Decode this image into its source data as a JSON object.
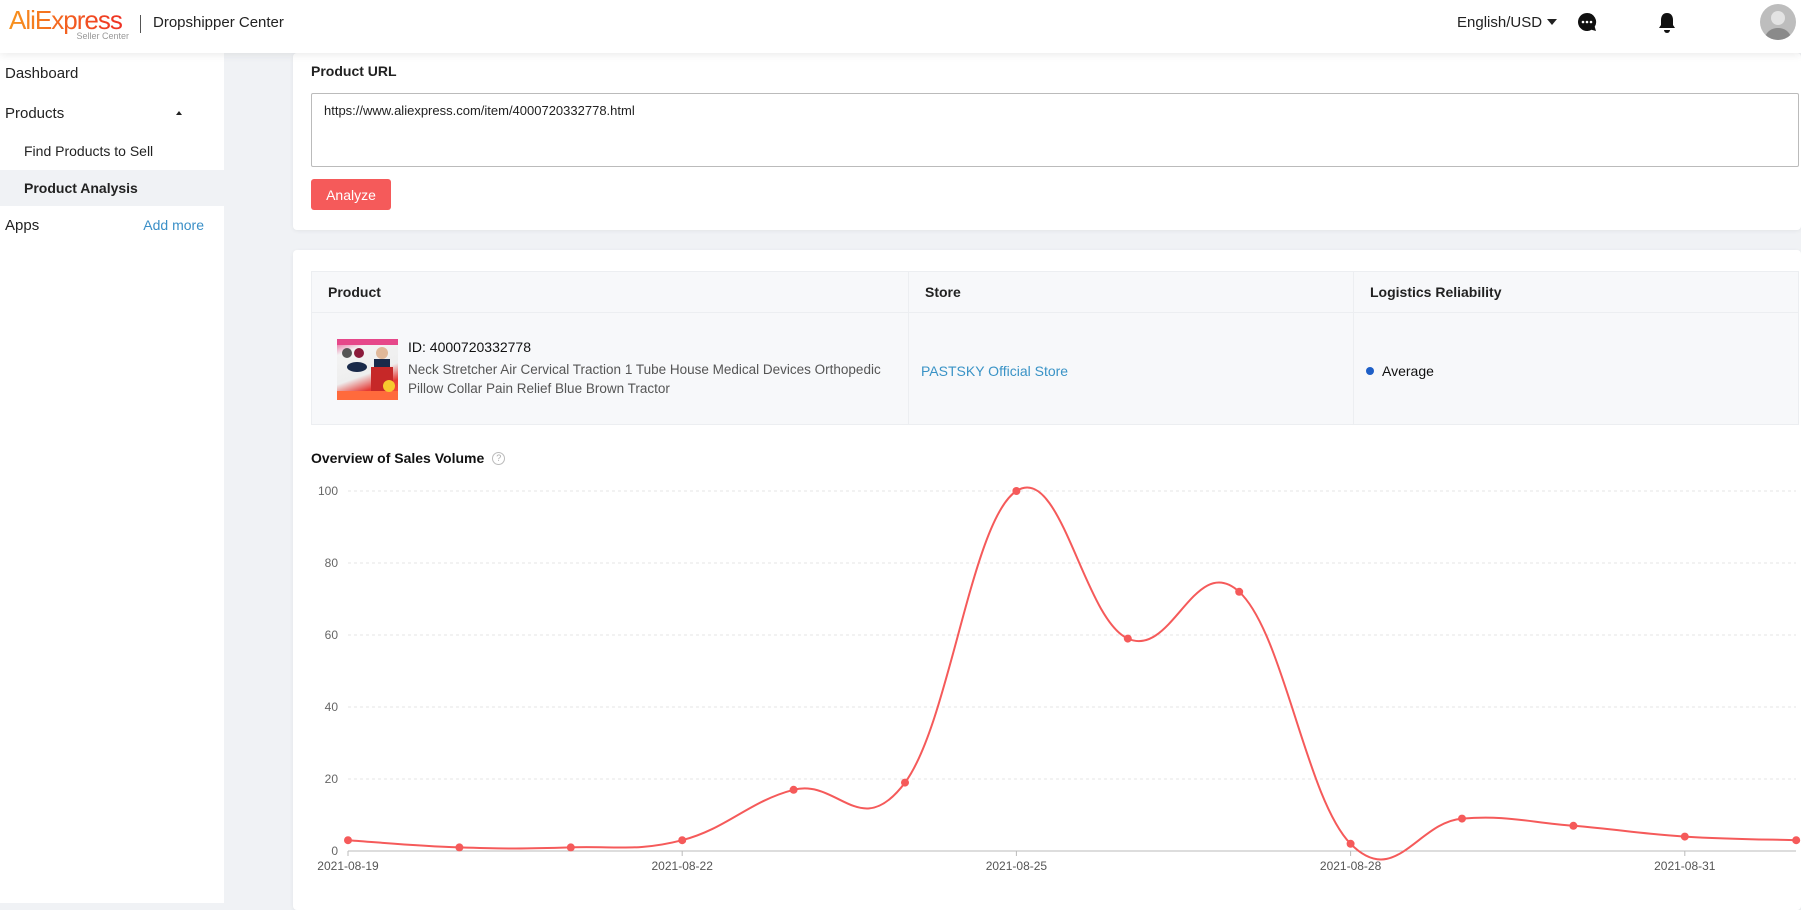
{
  "header": {
    "logo_text": "AliExpress",
    "logo_sub": "Seller Center",
    "app_title": "Dropshipper Center",
    "language": "English/USD",
    "icons": [
      "chat-icon",
      "bell-icon",
      "avatar"
    ]
  },
  "sidebar": {
    "items": [
      {
        "label": "Dashboard"
      },
      {
        "label": "Products"
      },
      {
        "label": "Find Products to Sell"
      },
      {
        "label": "Product Analysis",
        "active": true
      },
      {
        "label": "Apps"
      }
    ],
    "add_more": "Add more"
  },
  "url_card": {
    "label": "Product URL",
    "value": "https://www.aliexpress.com/item/4000720332778.html",
    "analyze_button": "Analyze",
    "accent": "#f55a5a"
  },
  "product_table": {
    "headers": [
      "Product",
      "Store",
      "Logistics Reliability"
    ],
    "row": {
      "id": "ID: 4000720332778",
      "name": "Neck Stretcher Air Cervical Traction 1 Tube House Medical Devices Orthopedic Pillow Collar Pain Relief Blue Brown Tractor",
      "store": "PASTSKY Official Store",
      "logistics": "Average",
      "logistics_color": "#1e5fc7"
    }
  },
  "chart_data": {
    "type": "line",
    "title": "Overview of Sales Volume",
    "x": [
      "2021-08-19",
      "2021-08-20",
      "2021-08-21",
      "2021-08-22",
      "2021-08-23",
      "2021-08-24",
      "2021-08-25",
      "2021-08-26",
      "2021-08-27",
      "2021-08-28",
      "2021-08-29",
      "2021-08-30",
      "2021-08-31",
      "2021-09-01"
    ],
    "values": [
      3,
      1,
      1,
      3,
      17,
      19,
      100,
      59,
      72,
      2,
      9,
      7,
      4,
      3
    ],
    "x_tick_labels": [
      "2021-08-19",
      "2021-08-22",
      "2021-08-25",
      "2021-08-28",
      "2021-08-31"
    ],
    "y_ticks": [
      "0",
      "20",
      "40",
      "60",
      "80",
      "100"
    ],
    "ylim": [
      0,
      100
    ],
    "grid": "horizontal dashed",
    "smooth": true,
    "color": "#f55a5a"
  }
}
